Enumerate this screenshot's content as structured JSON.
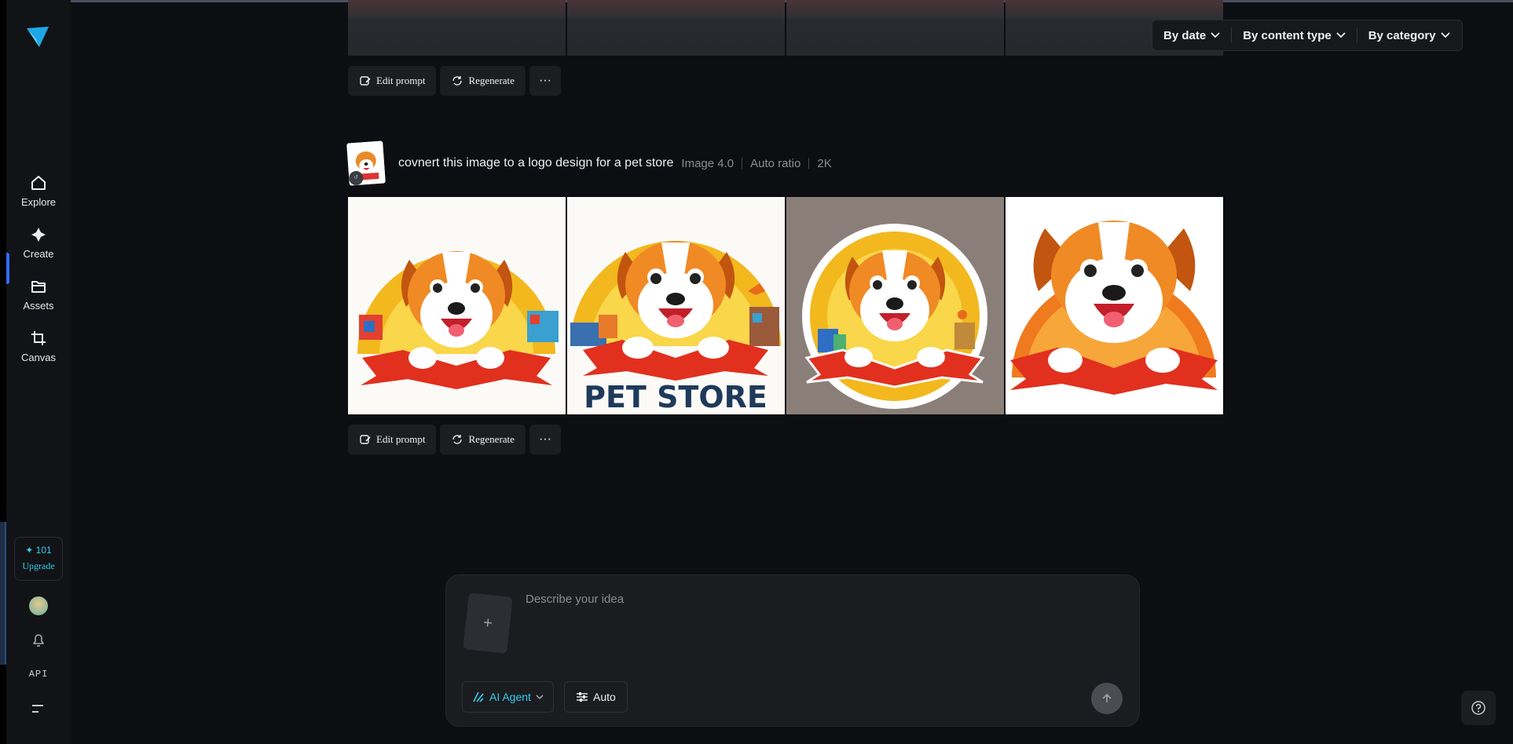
{
  "sidebar": {
    "nav": [
      {
        "label": "Explore",
        "icon": "home-icon"
      },
      {
        "label": "Create",
        "icon": "sparkle-icon"
      },
      {
        "label": "Assets",
        "icon": "folder-icon"
      },
      {
        "label": "Canvas",
        "icon": "crop-icon"
      }
    ],
    "credits": "✦ 101",
    "upgrade_label": "Upgrade",
    "api_label": "API"
  },
  "filters": {
    "by_date": "By date",
    "by_content_type": "By content type",
    "by_category": "By category"
  },
  "previous_generation": {
    "actions": {
      "edit_prompt": "Edit prompt",
      "regenerate": "Regenerate",
      "more": "···"
    }
  },
  "generation": {
    "prompt": "covnert this image to a logo design for a pet store",
    "model": "Image 4.0",
    "ratio": "Auto ratio",
    "resolution": "2K",
    "images": [
      {
        "caption": "",
        "background": "#fbfaf7"
      },
      {
        "caption": "PET STORE",
        "background": "#fbfaf7"
      },
      {
        "caption": "",
        "background": "#8a7f78"
      },
      {
        "caption": "",
        "background": "#ffffff"
      }
    ],
    "actions": {
      "edit_prompt": "Edit prompt",
      "regenerate": "Regenerate",
      "more": "···"
    }
  },
  "composer": {
    "placeholder": "Describe your idea",
    "add_symbol": "+",
    "agent_label": "AI Agent",
    "auto_label": "Auto"
  },
  "colors": {
    "accent": "#2fd0f0",
    "active_indicator": "#2f6bff",
    "background": "#0d0e11"
  }
}
